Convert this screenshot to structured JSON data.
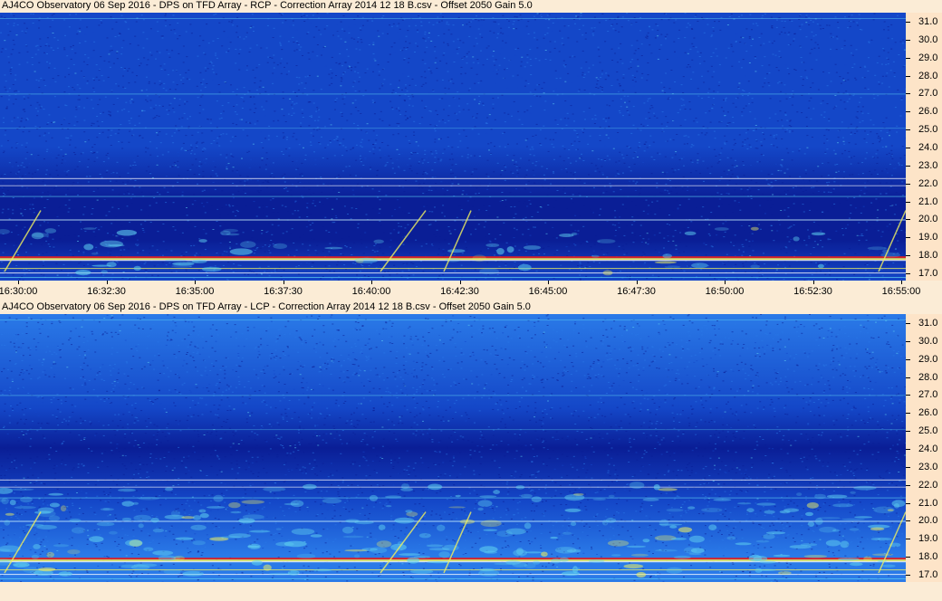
{
  "panels": [
    {
      "title": "AJ4CO Observatory 06 Sep 2016  -  DPS on TFD Array  -  RCP  -  Correction Array 2014 12 18 B.csv  -  Offset 2050  Gain 5.0",
      "polarization": "RCP"
    },
    {
      "title": "AJ4CO Observatory 06 Sep 2016  -  DPS on TFD Array  -  LCP  -  Correction Array 2014 12 18 B.csv  -  Offset 2050  Gain 5.0",
      "polarization": "LCP"
    }
  ],
  "chart_data": [
    {
      "type": "heatmap",
      "title": "AJ4CO Observatory 06 Sep 2016  -  DPS on TFD Array  -  RCP  -  Correction Array 2014 12 18 B.csv  -  Offset 2050  Gain 5.0",
      "x_tick_labels": [
        "16:30:00",
        "16:32:30",
        "16:35:00",
        "16:37:30",
        "16:40:00",
        "16:42:30",
        "16:45:00",
        "16:47:30",
        "16:50:00",
        "16:52:30",
        "16:55:00"
      ],
      "xlim": [
        "16:30:00",
        "16:55:00"
      ],
      "y_tick_labels": [
        "17.0",
        "18.0",
        "19.0",
        "20.0",
        "21.0",
        "22.0",
        "23.0",
        "24.0",
        "25.0",
        "26.0",
        "27.0",
        "28.0",
        "29.0",
        "30.0",
        "31.0"
      ],
      "ylim": [
        16.6,
        31.5
      ],
      "colormap": [
        "#0a1e96",
        "#1447c8",
        "#2a7ae8",
        "#5fd0f0",
        "#f0f060",
        "#e02020",
        "#ffffff"
      ]
    },
    {
      "type": "heatmap",
      "title": "AJ4CO Observatory 06 Sep 2016  -  DPS on TFD Array  -  LCP  -  Correction Array 2014 12 18 B.csv  -  Offset 2050  Gain 5.0",
      "x_tick_labels": [],
      "y_tick_labels": [
        "17.0",
        "18.0",
        "19.0",
        "20.0",
        "21.0",
        "22.0",
        "23.0",
        "24.0",
        "25.0",
        "26.0",
        "27.0",
        "28.0",
        "29.0",
        "30.0",
        "31.0"
      ],
      "ylim": [
        16.6,
        31.5
      ],
      "colormap": [
        "#0a1e96",
        "#1447c8",
        "#2a7ae8",
        "#5fd0f0",
        "#f0f060",
        "#e02020",
        "#ffffff"
      ]
    }
  ]
}
